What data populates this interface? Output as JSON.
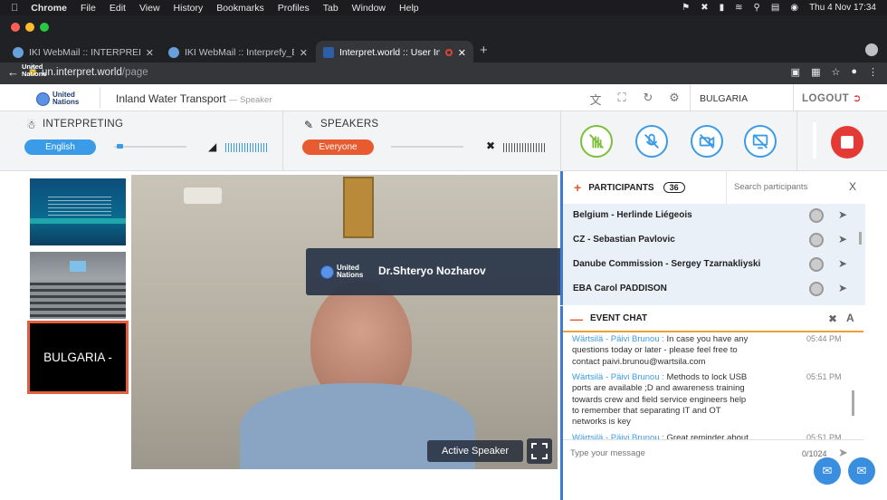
{
  "menubar": {
    "app": "Chrome",
    "items": [
      "File",
      "Edit",
      "View",
      "History",
      "Bookmarks",
      "Profiles",
      "Tab",
      "Window",
      "Help"
    ],
    "clock": "Thu 4 Nov  17:34"
  },
  "tabs": [
    {
      "title": "IKI WebMail :: INTERPREFY LIN",
      "active": false
    },
    {
      "title": "IKI WebMail :: Interprefy_ENG.c",
      "active": false
    },
    {
      "title": "Interpret.world :: User Inter",
      "active": true
    }
  ],
  "address": {
    "host": "un.interpret.world",
    "path": "/page"
  },
  "logo": {
    "line1": "United",
    "line2": "Nations"
  },
  "header": {
    "event_title": "Inland Water Transport",
    "role": "— Speaker",
    "country": "BULGARIA",
    "logout": "LOGOUT"
  },
  "controls": {
    "interpreting_label": "INTERPRETING",
    "language": "English",
    "speakers_label": "SPEAKERS",
    "speakers_value": "Everyone",
    "interpreting_volume": 0.04,
    "speakers_volume": 0.0,
    "colors": {
      "interp_pill": "#3a9be8",
      "speaker_pill": "#e85b30",
      "action_green": "#7bbf3a",
      "action_blue": "#3a9be8",
      "stop": "#e53935"
    }
  },
  "thumbnails": {
    "third_label": "BULGARIA -"
  },
  "video": {
    "speaker_name": "Dr.Shteryo Nozharov",
    "active_label": "Active Speaker"
  },
  "participants": {
    "title": "PARTICIPANTS",
    "count": "36",
    "search_placeholder": "Search participants",
    "clear": "X",
    "list": [
      "Belgium - Herlinde Liégeois",
      "CZ - Sebastian Pavlovic",
      "Danube Commission - Sergey Tzarnakliyski",
      "EBA Carol PADDISON"
    ]
  },
  "chat": {
    "title": "EVENT CHAT",
    "messages": [
      {
        "who": "Wärtsilä - Päivi Brunou :",
        "text": " In case you have any questions today or later - please feel free to contact paivi.brunou@wartsila.com",
        "time": "05:44 PM"
      },
      {
        "who": "Wärtsilä - Päivi Brunou :",
        "text": " Methods to lock USB ports are available ;D and awareness training towards crew and field service engineers help to remember that separating IT and OT networks is key",
        "time": "05:51 PM"
      },
      {
        "who": "Wärtsilä - Päivi Brunou :",
        "text": " Great reminder about",
        "time": "05:51 PM"
      }
    ],
    "input_placeholder": "Type your message",
    "char_count": "0/1024"
  }
}
